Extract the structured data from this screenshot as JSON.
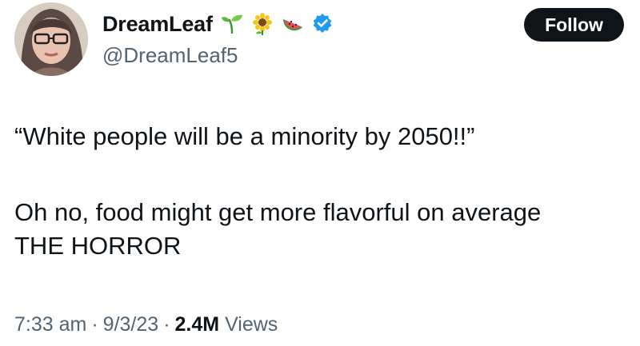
{
  "author": {
    "display_name": "DreamLeaf",
    "handle": "@DreamLeaf5",
    "name_emojis": [
      "seedling-icon",
      "sunflower-icon",
      "watermelon-icon"
    ],
    "verified_badge": "verified-badge-icon",
    "verified_color": "#1d9bf0"
  },
  "follow": {
    "label": "Follow",
    "background": "#0f1419"
  },
  "tweet": {
    "line1": "“White people will be a minority by 2050!!”",
    "line2": "Oh no, food might get more flavorful on average",
    "line3": "THE HORROR"
  },
  "meta": {
    "time": "7:33 am",
    "separator": "·",
    "date": "9/3/23",
    "views_count": "2.4M",
    "views_label": "Views"
  }
}
